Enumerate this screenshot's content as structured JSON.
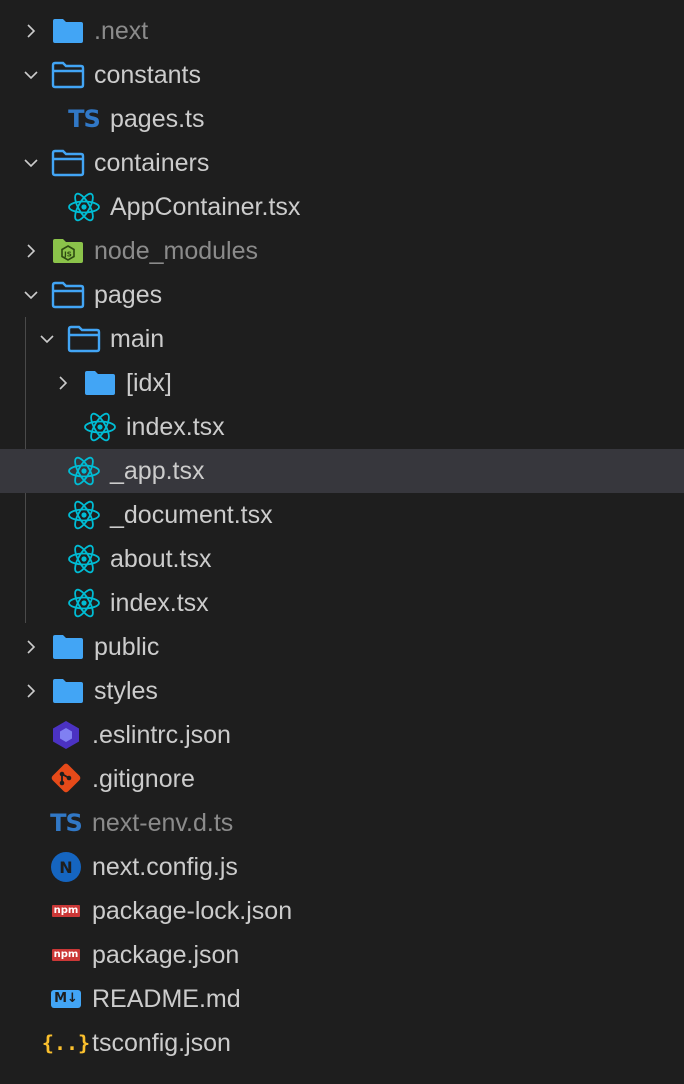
{
  "explorer": {
    "items": [
      {
        "label": ".next",
        "type": "folder",
        "state": "collapsed",
        "depth": 0,
        "dim": true
      },
      {
        "label": "constants",
        "type": "folder",
        "state": "expanded",
        "depth": 0
      },
      {
        "label": "pages.ts",
        "type": "typescript",
        "depth": 1
      },
      {
        "label": "containers",
        "type": "folder",
        "state": "expanded",
        "depth": 0
      },
      {
        "label": "AppContainer.tsx",
        "type": "react",
        "depth": 1
      },
      {
        "label": "node_modules",
        "type": "node-folder",
        "state": "collapsed",
        "depth": 0,
        "dim": true
      },
      {
        "label": "pages",
        "type": "folder",
        "state": "expanded",
        "depth": 0
      },
      {
        "label": "main",
        "type": "folder",
        "state": "expanded",
        "depth": 1
      },
      {
        "label": "[idx]",
        "type": "folder",
        "state": "collapsed",
        "depth": 2
      },
      {
        "label": "index.tsx",
        "type": "react",
        "depth": 2
      },
      {
        "label": "_app.tsx",
        "type": "react",
        "depth": 1,
        "selected": true
      },
      {
        "label": "_document.tsx",
        "type": "react",
        "depth": 1
      },
      {
        "label": "about.tsx",
        "type": "react",
        "depth": 1
      },
      {
        "label": "index.tsx",
        "type": "react",
        "depth": 1
      },
      {
        "label": "public",
        "type": "folder",
        "state": "collapsed",
        "depth": 0
      },
      {
        "label": "styles",
        "type": "folder",
        "state": "collapsed",
        "depth": 0
      },
      {
        "label": ".eslintrc.json",
        "type": "eslint",
        "depth": 0,
        "file_root": true
      },
      {
        "label": ".gitignore",
        "type": "git",
        "depth": 0,
        "file_root": true
      },
      {
        "label": "next-env.d.ts",
        "type": "typescript",
        "depth": 0,
        "file_root": true,
        "dim": true
      },
      {
        "label": "next.config.js",
        "type": "next",
        "depth": 0,
        "file_root": true
      },
      {
        "label": "package-lock.json",
        "type": "npm",
        "depth": 0,
        "file_root": true
      },
      {
        "label": "package.json",
        "type": "npm",
        "depth": 0,
        "file_root": true
      },
      {
        "label": "README.md",
        "type": "markdown",
        "depth": 0,
        "file_root": true
      },
      {
        "label": "tsconfig.json",
        "type": "json",
        "depth": 0,
        "file_root": true
      }
    ]
  },
  "badges": {
    "ts": "TS",
    "npm": "npm",
    "md": "M↓",
    "json": "{..}",
    "next": "N",
    "node": "JS"
  },
  "colors": {
    "background": "#1e1e1e",
    "text": "#cccccc",
    "text_dim": "#8b8b8b",
    "folder": "#42a5f5",
    "typescript": "#3178c6",
    "react": "#00bcd4",
    "selected_row": "#37373d"
  },
  "icons": {
    "folder": "folder-icon",
    "folder_open": "folder-open-icon",
    "react": "react-icon",
    "typescript": "typescript-icon",
    "node": "nodejs-folder-icon",
    "eslint": "eslint-icon",
    "git": "git-icon",
    "next": "nextjs-icon",
    "npm": "npm-icon",
    "markdown": "markdown-icon",
    "json": "json-icon",
    "chevron_right": "chevron-right-icon",
    "chevron_down": "chevron-down-icon"
  }
}
